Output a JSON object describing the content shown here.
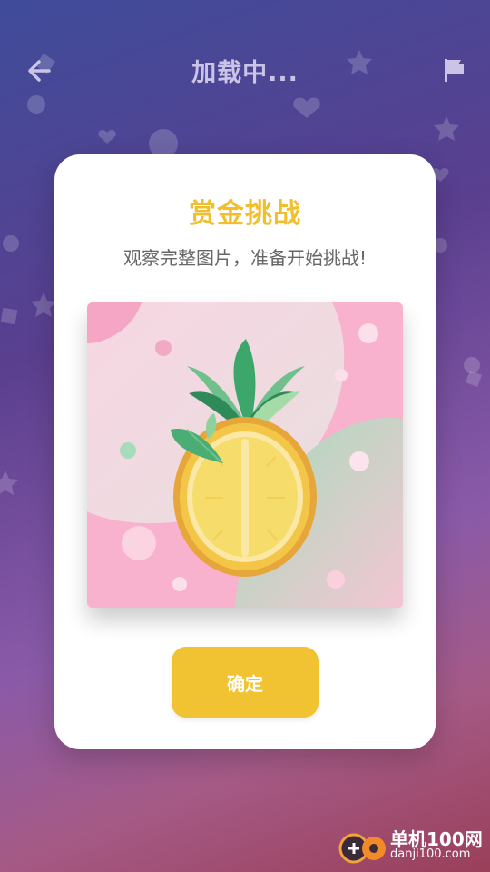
{
  "header": {
    "title": "加载中...",
    "back_icon": "arrow-left-icon",
    "flag_icon": "flag-icon"
  },
  "dialog": {
    "title": "赏金挑战",
    "subtitle": "观察完整图片，准备开始挑战!",
    "image_subject": "pineapple-illustration",
    "confirm_label": "确定"
  },
  "watermark": {
    "line1": "单机100网",
    "line2": "danji100.com"
  },
  "colors": {
    "accent": "#f1bf2c",
    "button": "#f1c231",
    "header_text": "#cbc4e6"
  }
}
